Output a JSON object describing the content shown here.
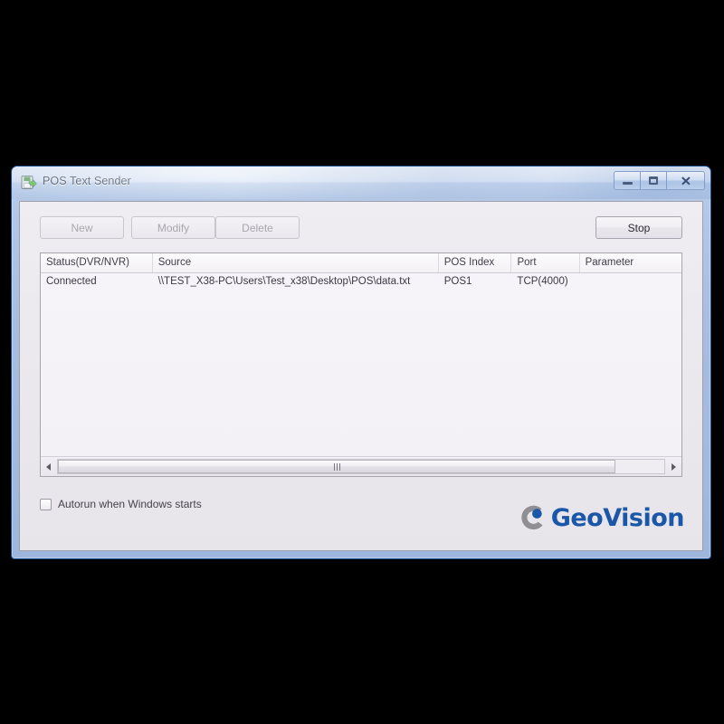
{
  "window": {
    "title": "POS Text Sender",
    "icon": "pos-sender-app-icon",
    "controls": {
      "minimize": "minimize-button",
      "maximize": "maximize-button",
      "close": "close-button",
      "close_glyph": "✕"
    }
  },
  "toolbar": {
    "new_label": "New",
    "modify_label": "Modify",
    "delete_label": "Delete",
    "stop_label": "Stop"
  },
  "listview": {
    "columns": [
      "Status(DVR/NVR)",
      "Source",
      "POS Index",
      "Port",
      "Parameter"
    ],
    "rows": [
      {
        "status": "Connected",
        "source": "\\\\TEST_X38-PC\\Users\\Test_x38\\Desktop\\POS\\data.txt",
        "pos_index": "POS1",
        "port": "TCP(4000)",
        "parameter": ""
      }
    ]
  },
  "options": {
    "autorun_label": "Autorun when Windows starts",
    "autorun_checked": false
  },
  "branding": {
    "logo_text": "GeoVision",
    "logo_blue": "#1a57a8",
    "logo_grey": "#8e8e93"
  }
}
